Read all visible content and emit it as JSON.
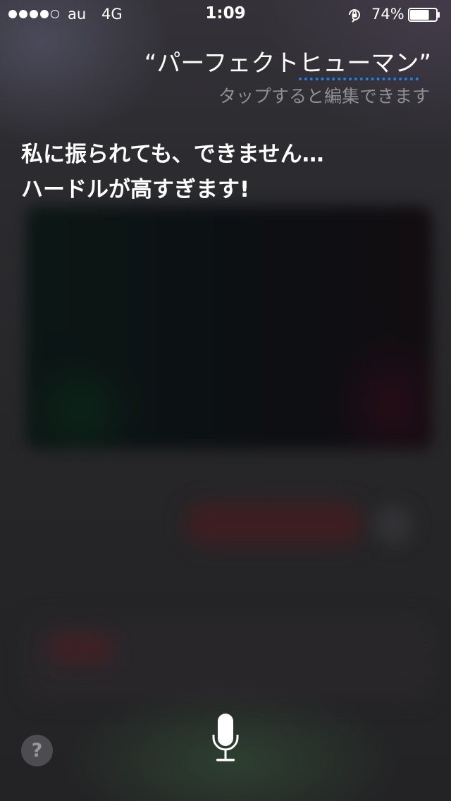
{
  "status_bar": {
    "signal_dots_filled": 4,
    "signal_dots_total": 5,
    "carrier": "au",
    "network": "4G",
    "time": "1:09",
    "orientation_lock_icon": "orientation-lock-icon",
    "battery_percent": "74%",
    "battery_level": 0.74
  },
  "query": {
    "open_quote": "“",
    "certain_text": "パーフェクト",
    "uncertain_text": "ヒューマン",
    "close_quote": "”",
    "hint": "タップすると編集できます",
    "uncertain_underline_color": "#1f7fe6"
  },
  "response": {
    "text": "私に振られても、できません…ハードルが高すぎます!"
  },
  "controls": {
    "help_label": "?",
    "help_icon": "question-mark-icon",
    "mic_icon": "microphone-icon"
  }
}
